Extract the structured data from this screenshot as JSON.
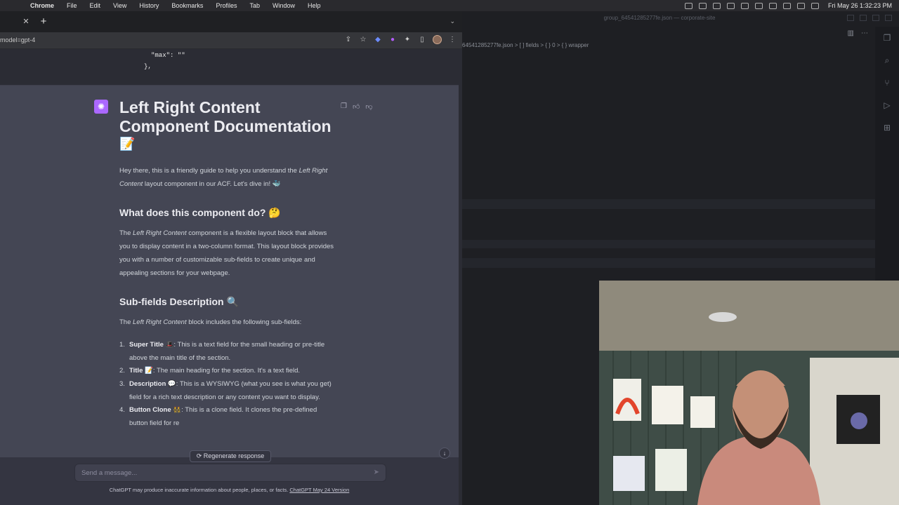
{
  "menubar": {
    "app": "Chrome",
    "items": [
      "File",
      "Edit",
      "View",
      "History",
      "Bookmarks",
      "Profiles",
      "Tab",
      "Window",
      "Help"
    ],
    "clock": "Fri May 26  1:32:23 PM"
  },
  "browser": {
    "url": "model=gpt-4",
    "code_line_1": "\"max\": \"\"",
    "code_line_2": "},"
  },
  "message": {
    "title": "Left Right Content Component Documentation",
    "title_emoji": "📝",
    "intro_1": "Hey there, this is a friendly guide to help you understand the ",
    "intro_em": "Left Right Content",
    "intro_2": " layout component in our ACF. Let's dive in! 🐳",
    "h2_1": "What does this component do? 🤔",
    "p2_1": "The ",
    "p2_em": "Left Right Content",
    "p2_2": " component is a flexible layout block that allows you to display content in a two-column format. This layout block provides you with a number of customizable sub-fields to create unique and appealing sections for your webpage.",
    "h2_2": "Sub-fields Description 🔍",
    "p3_1": "The ",
    "p3_em": "Left Right Content",
    "p3_2": " block includes the following sub-fields:",
    "list": [
      {
        "num": "1.",
        "name": "Super Title",
        "emoji": "🎩",
        "text": ": This is a text field for the small heading or pre-title above the main title of the section."
      },
      {
        "num": "2.",
        "name": "Title",
        "emoji": "📝",
        "text": ": The main heading for the section. It's a text field."
      },
      {
        "num": "3.",
        "name": "Description",
        "emoji": "💬",
        "text": ": This is a WYSIWYG (what you see is what you get) field for a rich text description or any content you want to display."
      },
      {
        "num": "4.",
        "name": "Button Clone",
        "emoji": "👯",
        "text": ": This is a clone field. It clones the pre-defined button field for re"
      }
    ]
  },
  "composer": {
    "regenerate_label": "Regenerate response",
    "placeholder": "Send a message..."
  },
  "footer": {
    "text": "ChatGPT may produce inaccurate information about people, places, or facts. ",
    "link": "ChatGPT May 24 Version"
  },
  "vscode": {
    "title": "group_64541285277fe.json — corporate-site",
    "breadcrumb": "64541285277fe.json > [ ] fields > { } 0 > { } wrapper"
  },
  "colors": {
    "chat_bg": "#343541",
    "assistant_bg": "#444654",
    "avatar_purple": "#ab68ff",
    "vscode_accent": "#2f6fc7"
  }
}
